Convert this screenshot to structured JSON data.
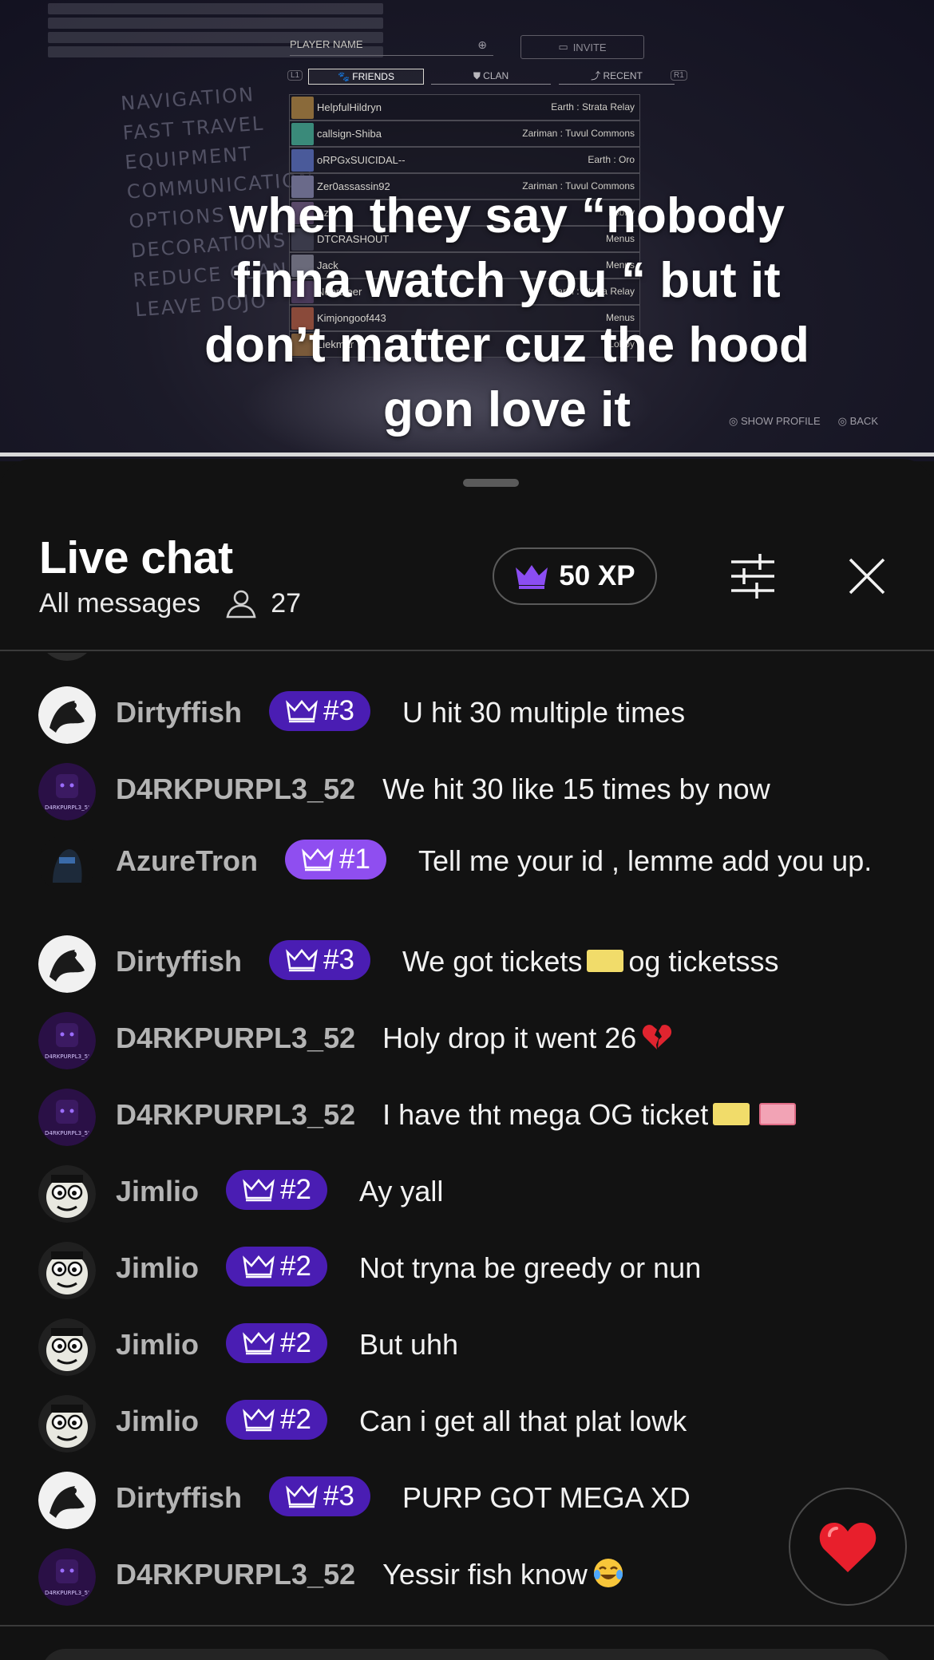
{
  "stream": {
    "menu_items": [
      "NAVIGATION",
      "FAST TRAVEL",
      "EQUIPMENT",
      "COMMUNICATION",
      "OPTIONS",
      "DECORATIONS",
      "REDUCE CLAN",
      "LEAVE DOJO"
    ],
    "player_name_label": "PLAYER NAME",
    "invite_label": "INVITE",
    "tabs": [
      "FRIENDS",
      "CLAN",
      "RECENT"
    ],
    "tab_keys": [
      "L1",
      "R1"
    ],
    "friends": [
      {
        "name": "HelpfulHildryn",
        "status": "Earth : Strata Relay"
      },
      {
        "name": "callsign-Shiba",
        "status": "Zariman : Tuvul Commons"
      },
      {
        "name": "oRPGxSUICIDAL--",
        "status": "Earth : Oro"
      },
      {
        "name": "Zer0assassin92",
        "status": "Zariman : Tuvul Commons"
      },
      {
        "name": "Azu",
        "status": "Lobby"
      },
      {
        "name": "DTCRASHOUT",
        "status": "Menus"
      },
      {
        "name": "Jack",
        "status": "Menus"
      },
      {
        "name": "NeerDeer",
        "status": "Earth : Strata Relay"
      },
      {
        "name": "Kimjongoof443",
        "status": "Menus"
      },
      {
        "name": "Liekmar",
        "status": "Lobby"
      }
    ],
    "show_profile_label": "SHOW PROFILE",
    "back_label": "BACK"
  },
  "caption": "when they say “nobody finna watch you “ but it don’t matter cuz the hood gon love it",
  "chat": {
    "title": "Live chat",
    "filter_label": "All messages",
    "viewer_count": "27",
    "xp_label": "50 XP",
    "accent": "#4a1db3",
    "accent_rank1": "#8f4ef0",
    "messages": [
      {
        "user": "Dirtyffish",
        "badge": "#3",
        "text": "U hit 30 multiple times",
        "avatar": "fish"
      },
      {
        "user": "D4RKPURPL3_52",
        "badge": "",
        "text": "We hit 30 like 15 times by now",
        "avatar": "purple"
      },
      {
        "user": "AzureTron",
        "badge": "#1",
        "text": "Tell me your id , lemme add you up.",
        "avatar": "azure"
      },
      {
        "user": "Dirtyffish",
        "badge": "#3",
        "text": "We got tickets",
        "text2": "og ticketsss",
        "avatar": "fish"
      },
      {
        "user": "D4RKPURPL3_52",
        "badge": "",
        "text": "Holy drop it went 26",
        "avatar": "purple"
      },
      {
        "user": "D4RKPURPL3_52",
        "badge": "",
        "text": "I have tht mega OG ticket",
        "avatar": "purple"
      },
      {
        "user": "Jimlio",
        "badge": "#2",
        "text": "Ay yall",
        "avatar": "jim"
      },
      {
        "user": "Jimlio",
        "badge": "#2",
        "text": "Not tryna be greedy or nun",
        "avatar": "jim"
      },
      {
        "user": "Jimlio",
        "badge": "#2",
        "text": "But uhh",
        "avatar": "jim"
      },
      {
        "user": "Jimlio",
        "badge": "#2",
        "text": "Can i get all that plat lowk",
        "avatar": "jim"
      },
      {
        "user": "Dirtyffish",
        "badge": "#3",
        "text": "PURP GOT MEGA XD",
        "avatar": "fish"
      },
      {
        "user": "D4RKPURPL3_52",
        "badge": "",
        "text": "Yessir fish know",
        "avatar": "purple"
      }
    ]
  }
}
